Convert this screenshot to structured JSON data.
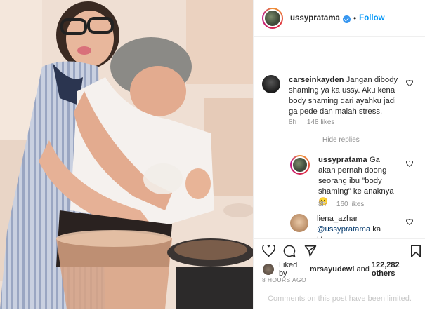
{
  "post": {
    "username": "ussypratama",
    "follow_label": "Follow",
    "dot": "•"
  },
  "comments": [
    {
      "username": "carseinkayden",
      "text": "Jangan dibody shaming ya ka ussy. Aku kena body shaming dari ayahku jadi ga pede dan malah stress.",
      "time": "8h",
      "likes": "148 likes"
    },
    {
      "username": "ussypratama",
      "text": "Ga akan pernah doong seorang ibu \"body shaming\" ke anaknya😬",
      "time": "8h",
      "likes": "160 likes"
    },
    {
      "username": "liena_azhar",
      "mention": "@ussypratama",
      "text": "ka Ussy"
    }
  ],
  "hide_replies_label": "Hide replies",
  "likes_line": {
    "prefix": "Liked by",
    "user": "mrsayudewi",
    "middle": "and",
    "count": "122,282 others"
  },
  "timestamp": "8 HOURS AGO",
  "comments_limited": "Comments on this post have been limited."
}
